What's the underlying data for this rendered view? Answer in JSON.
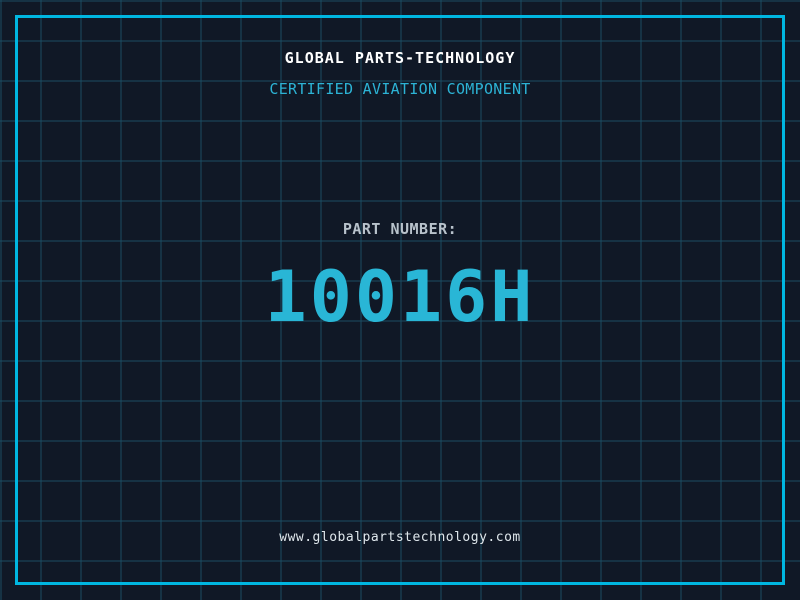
{
  "page": {
    "title": "GLOBAL PARTS-TECHNOLOGY",
    "subtitle": "CERTIFIED AVIATION COMPONENT",
    "part_label": "PART NUMBER:",
    "part_number": "10016H",
    "website": "www.globalpartstechnology.com"
  },
  "colors": {
    "background": "#101826",
    "grid_line": "#1b4d63",
    "frame_border": "#00b6e0",
    "accent_cyan": "#29b6d6",
    "title_text": "#ffffff",
    "label_text": "#b8c2cb",
    "website_text": "#dfe7ec"
  }
}
